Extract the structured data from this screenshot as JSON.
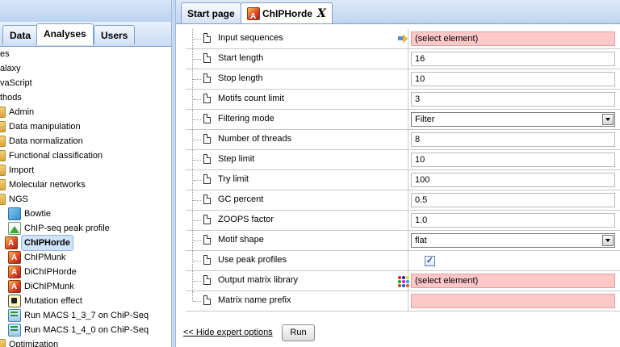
{
  "left_panel": {
    "tabs": [
      {
        "label": "Data"
      },
      {
        "label": "Analyses"
      },
      {
        "label": "Users"
      }
    ],
    "active_tab": "Analyses",
    "tree": [
      {
        "label": "es"
      },
      {
        "label": "alaxy"
      },
      {
        "label": "vaScript"
      },
      {
        "label": "thods"
      },
      {
        "label": "Admin"
      },
      {
        "label": "Data manipulation"
      },
      {
        "label": "Data normalization"
      },
      {
        "label": "Functional classification"
      },
      {
        "label": "Import"
      },
      {
        "label": "Molecular networks"
      },
      {
        "label": "NGS"
      },
      {
        "label": "Bowtie",
        "icon": "bowtie-icon"
      },
      {
        "label": "ChIP-seq peak profile",
        "icon": "peak-profile-icon"
      },
      {
        "label": "ChIPHorde",
        "icon": "motif-icon",
        "selected": true
      },
      {
        "label": "ChIPMunk",
        "icon": "motif-icon"
      },
      {
        "label": "DiChIPHorde",
        "icon": "motif-icon"
      },
      {
        "label": "DiChIPMunk",
        "icon": "motif-icon"
      },
      {
        "label": "Mutation effect",
        "icon": "mutation-icon"
      },
      {
        "label": "Run MACS 1_3_7 on ChiP-Seq",
        "icon": "macs-icon"
      },
      {
        "label": "Run MACS 1_4_0 on ChiP-Seq",
        "icon": "macs-icon"
      },
      {
        "label": "Optimization"
      }
    ]
  },
  "document_tabs": [
    {
      "label": "Start page"
    },
    {
      "label": "ChIPHorde",
      "close": "X",
      "active": true
    }
  ],
  "params": [
    {
      "name": "Input sequences",
      "value": "(select element)",
      "kind": "element",
      "icon": "arrow-element-icon"
    },
    {
      "name": "Start length",
      "value": "16",
      "kind": "text"
    },
    {
      "name": "Stop length",
      "value": "10",
      "kind": "text"
    },
    {
      "name": "Motifs count limit",
      "value": "3",
      "kind": "text"
    },
    {
      "name": "Filtering mode",
      "value": "Filter",
      "kind": "select"
    },
    {
      "name": "Number of threads",
      "value": "8",
      "kind": "text"
    },
    {
      "name": "Step limit",
      "value": "10",
      "kind": "text"
    },
    {
      "name": "Try limit",
      "value": "100",
      "kind": "text"
    },
    {
      "name": "GC percent",
      "value": "0.5",
      "kind": "text"
    },
    {
      "name": "ZOOPS factor",
      "value": "1.0",
      "kind": "text"
    },
    {
      "name": "Motif shape",
      "value": "flat",
      "kind": "select"
    },
    {
      "name": "Use peak profiles",
      "value": "✓",
      "kind": "checkbox"
    },
    {
      "name": "Output matrix library",
      "value": "(select element)",
      "kind": "element",
      "icon": "matrix-library-icon"
    },
    {
      "name": "Matrix name prefix",
      "value": "",
      "kind": "pinktext"
    }
  ],
  "footer": {
    "hide_link": "<< Hide expert options",
    "run_label": "Run"
  }
}
